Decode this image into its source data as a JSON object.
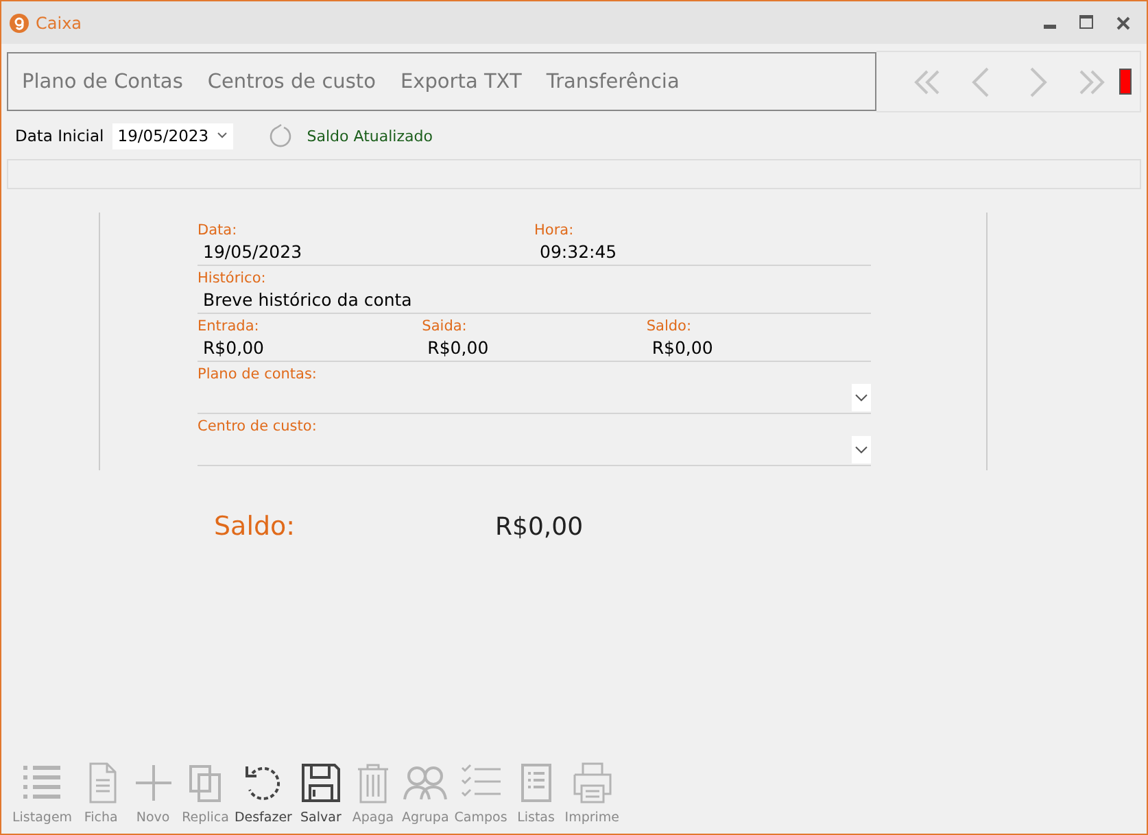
{
  "window": {
    "title": "Caixa"
  },
  "tabs": [
    {
      "label": "Plano de Contas"
    },
    {
      "label": "Centros de custo"
    },
    {
      "label": "Exporta TXT"
    },
    {
      "label": "Transferência"
    }
  ],
  "filter": {
    "label": "Data Inicial",
    "value": "19/05/2023",
    "status": "Saldo Atualizado"
  },
  "form": {
    "rows": [
      [
        {
          "label": "Data:",
          "value": "19/05/2023",
          "kind": "text"
        },
        {
          "label": "Hora:",
          "value": "09:32:45",
          "kind": "text"
        }
      ],
      [
        {
          "label": "Histórico:",
          "value": "Breve histórico da conta",
          "kind": "text"
        }
      ],
      [
        {
          "label": "Entrada:",
          "value": "R$0,00",
          "kind": "text"
        },
        {
          "label": "Saida:",
          "value": "R$0,00",
          "kind": "text"
        },
        {
          "label": "Saldo:",
          "value": "R$0,00",
          "kind": "text"
        }
      ],
      [
        {
          "label": "Plano de contas:",
          "kind": "combo"
        }
      ],
      [
        {
          "label": "Centro de custo:",
          "kind": "combo"
        }
      ]
    ]
  },
  "balance": {
    "label": "Saldo:",
    "value": "R$0,00"
  },
  "toolbar": [
    {
      "label": "Listagem",
      "kind": "list",
      "disabled": true
    },
    {
      "label": "Ficha",
      "kind": "sheet",
      "disabled": true
    },
    {
      "label": "Novo",
      "kind": "plus",
      "disabled": true
    },
    {
      "label": "Replica",
      "kind": "copy",
      "disabled": true
    },
    {
      "label": "Desfazer",
      "kind": "undo",
      "disabled": false
    },
    {
      "label": "Salvar",
      "kind": "save",
      "disabled": false
    },
    {
      "label": "Apaga",
      "kind": "trash",
      "disabled": true
    },
    {
      "label": "Agrupa",
      "kind": "group",
      "disabled": true
    },
    {
      "label": "Campos",
      "kind": "fields",
      "disabled": true
    },
    {
      "label": "Listas",
      "kind": "lists",
      "disabled": true
    },
    {
      "label": "Imprime",
      "kind": "print",
      "disabled": true
    }
  ]
}
